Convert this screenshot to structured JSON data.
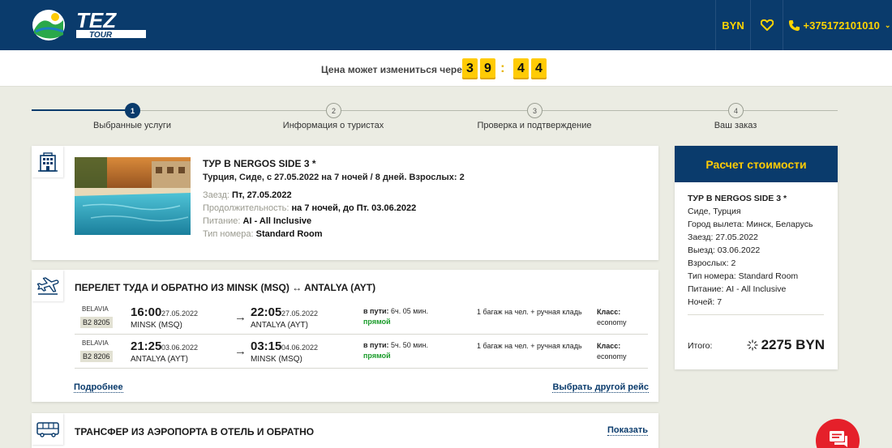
{
  "header": {
    "logo_text": "TEZ",
    "logo_sub": "TOUR",
    "currency": "BYN",
    "phone": "+375172101010",
    "colors": {
      "bg": "#0a3b6c",
      "accent": "#ffd400"
    }
  },
  "timer": {
    "label": "Цена может измениться через",
    "digits": [
      "3",
      "9",
      "4",
      "4"
    ],
    "separator": ":"
  },
  "steps": [
    {
      "num": "1",
      "label": "Выбранные услуги"
    },
    {
      "num": "2",
      "label": "Информация о туристах"
    },
    {
      "num": "3",
      "label": "Проверка и подтверждение"
    },
    {
      "num": "4",
      "label": "Ваш заказ"
    }
  ],
  "hotel": {
    "title": "ТУР В NERGOS SIDE 3 *",
    "subtitle": "Турция, Сиде, с 27.05.2022 на 7 ночей / 8 дней. Взрослых: 2",
    "checkin_k": "Заезд:",
    "checkin_v": "Пт, 27.05.2022",
    "duration_k": "Продолжительность:",
    "duration_v": "на 7 ночей, до Пт. 03.06.2022",
    "meal_k": "Питание:",
    "meal_v": "AI - All Inclusive",
    "room_k": "Тип номера:",
    "room_v": "Standard Room"
  },
  "flight": {
    "title": "ПЕРЕЛЕТ ТУДА И ОБРАТНО ИЗ MINSK (MSQ) ↔ ANTALYA (AYT)",
    "rows": [
      {
        "airline": "BELAVIA",
        "code": "B2 8205",
        "dep_time": "16:00",
        "dep_date": "27.05.2022",
        "dep_city": "MINSK (MSQ)",
        "arr_time": "22:05",
        "arr_date": "27.05.2022",
        "arr_city": "ANTALYA (AYT)",
        "dur_label": "в пути:",
        "dur": "6ч. 05 мин.",
        "direct": "прямой",
        "baggage": "1 багаж на чел. + ручная кладь",
        "class_label": "Класс:",
        "class": "economy"
      },
      {
        "airline": "BELAVIA",
        "code": "B2 8206",
        "dep_time": "21:25",
        "dep_date": "03.06.2022",
        "dep_city": "ANTALYA (AYT)",
        "arr_time": "03:15",
        "arr_date": "04.06.2022",
        "arr_city": "MINSK (MSQ)",
        "dur_label": "в пути:",
        "dur": "5ч. 50 мин.",
        "direct": "прямой",
        "baggage": "1 багаж на чел. + ручная кладь",
        "class_label": "Класс:",
        "class": "economy"
      }
    ],
    "more_link": "Подробнее",
    "other_link": "Выбрать другой рейс"
  },
  "transfer": {
    "title": "ТРАНСФЕР ИЗ АЭРОПОРТА В ОТЕЛЬ И ОБРАТНО",
    "show_link": "Показать"
  },
  "price": {
    "header": "Расчет стоимости",
    "title": "ТУР В NERGOS SIDE 3 *",
    "lines": [
      "Сиде, Турция",
      "Город вылета: Минск, Беларусь",
      "Заезд: 27.05.2022",
      "Выезд: 03.06.2022",
      "Взрослых: 2",
      "Тип номера: Standard Room",
      "Питание: AI - All Inclusive",
      "Ночей: 7"
    ],
    "total_label": "Итого:",
    "total_value": "2275 BYN"
  }
}
